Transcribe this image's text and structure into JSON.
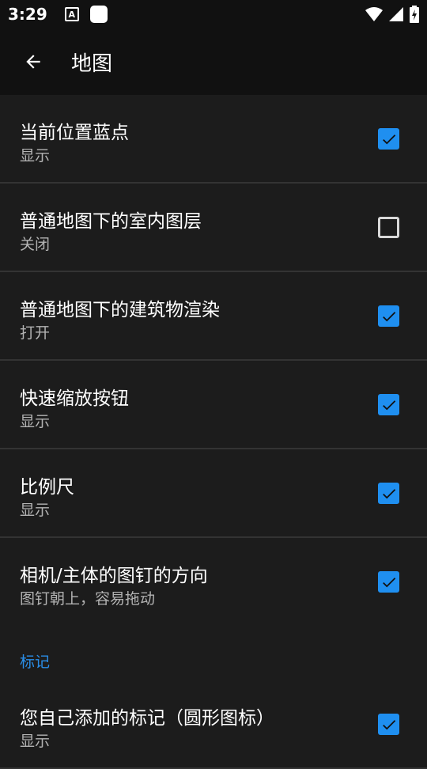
{
  "status_bar": {
    "time": "3:29"
  },
  "app_bar": {
    "title": "地图"
  },
  "rows": [
    {
      "title": "当前位置蓝点",
      "summary": "显示",
      "checked": true
    },
    {
      "title": "普通地图下的室内图层",
      "summary": "关闭",
      "checked": false
    },
    {
      "title": "普通地图下的建筑物渲染",
      "summary": "打开",
      "checked": true
    },
    {
      "title": "快速缩放按钮",
      "summary": "显示",
      "checked": true
    },
    {
      "title": "比例尺",
      "summary": "显示",
      "checked": true
    },
    {
      "title": "相机/主体的图钉的方向",
      "summary": "图钉朝上，容易拖动",
      "checked": true
    }
  ],
  "section": {
    "label": "标记"
  },
  "section_rows": [
    {
      "title": "您自己添加的标记（圆形图标）",
      "summary": "显示",
      "checked": true
    }
  ],
  "colors": {
    "accent": "#1f8ff0",
    "section": "#2a8ee8",
    "background": "#1c1c1c",
    "bar": "#111111"
  }
}
